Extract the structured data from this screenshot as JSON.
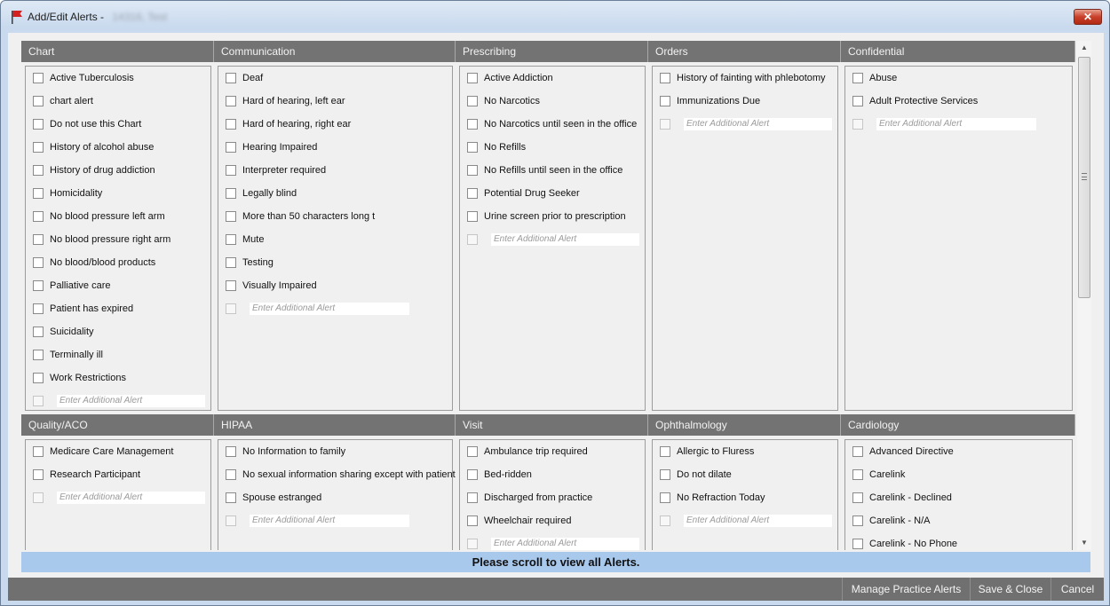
{
  "window": {
    "title": "Add/Edit Alerts - ",
    "patient_redacted": "14316, Test",
    "close_glyph": "✕"
  },
  "placeholder": "Enter Additional Alert",
  "sections_row1": [
    {
      "header": "Chart",
      "items": [
        "Active Tuberculosis",
        "chart alert",
        "Do not use this Chart",
        "History of alcohol abuse",
        "History of drug addiction",
        "Homicidality",
        "No blood pressure left arm",
        "No blood pressure right arm",
        "No blood/blood products",
        "Palliative care",
        "Patient has expired",
        "Suicidality",
        "Terminally ill",
        "Work Restrictions"
      ]
    },
    {
      "header": "Communication",
      "items": [
        "Deaf",
        "Hard of hearing, left ear",
        "Hard of hearing, right ear",
        "Hearing Impaired",
        "Interpreter required",
        "Legally blind",
        "More than 50 characters long t",
        "Mute",
        "Testing",
        "Visually Impaired"
      ]
    },
    {
      "header": "Prescribing",
      "items": [
        "Active Addiction",
        "No Narcotics",
        "No Narcotics until seen in the office",
        "No Refills",
        "No Refills until seen in the office",
        "Potential Drug Seeker",
        "Urine screen prior to prescription"
      ]
    },
    {
      "header": "Orders",
      "items": [
        "History of fainting with phlebotomy",
        "Immunizations Due"
      ]
    },
    {
      "header": "Confidential",
      "items": [
        "Abuse",
        "Adult Protective Services"
      ]
    }
  ],
  "sections_row2": [
    {
      "header": "Quality/ACO",
      "items": [
        "Medicare Care Management",
        "Research Participant"
      ]
    },
    {
      "header": "HIPAA",
      "items": [
        "No Information to family",
        "No sexual information sharing except with patient",
        "Spouse estranged"
      ]
    },
    {
      "header": "Visit",
      "items": [
        "Ambulance trip required",
        "Bed-ridden",
        "Discharged from practice",
        "Wheelchair required"
      ]
    },
    {
      "header": "Ophthalmology",
      "items": [
        "Allergic to Fluress",
        "Do not dilate",
        "No Refraction Today"
      ]
    },
    {
      "header": "Cardiology",
      "items": [
        "Advanced Directive",
        "Carelink",
        "Carelink - Declined",
        "Carelink - N/A",
        "Carelink - No Phone"
      ],
      "no_placeholder": true
    }
  ],
  "notice": "Please scroll to view all Alerts.",
  "footer": {
    "manage_label": "Manage Practice Alerts",
    "save_label": "Save & Close",
    "cancel_label": "Cancel"
  },
  "colors": {
    "flag": "#d42020",
    "header_bar": "#737373",
    "notice_bg": "#a8c8ec"
  }
}
